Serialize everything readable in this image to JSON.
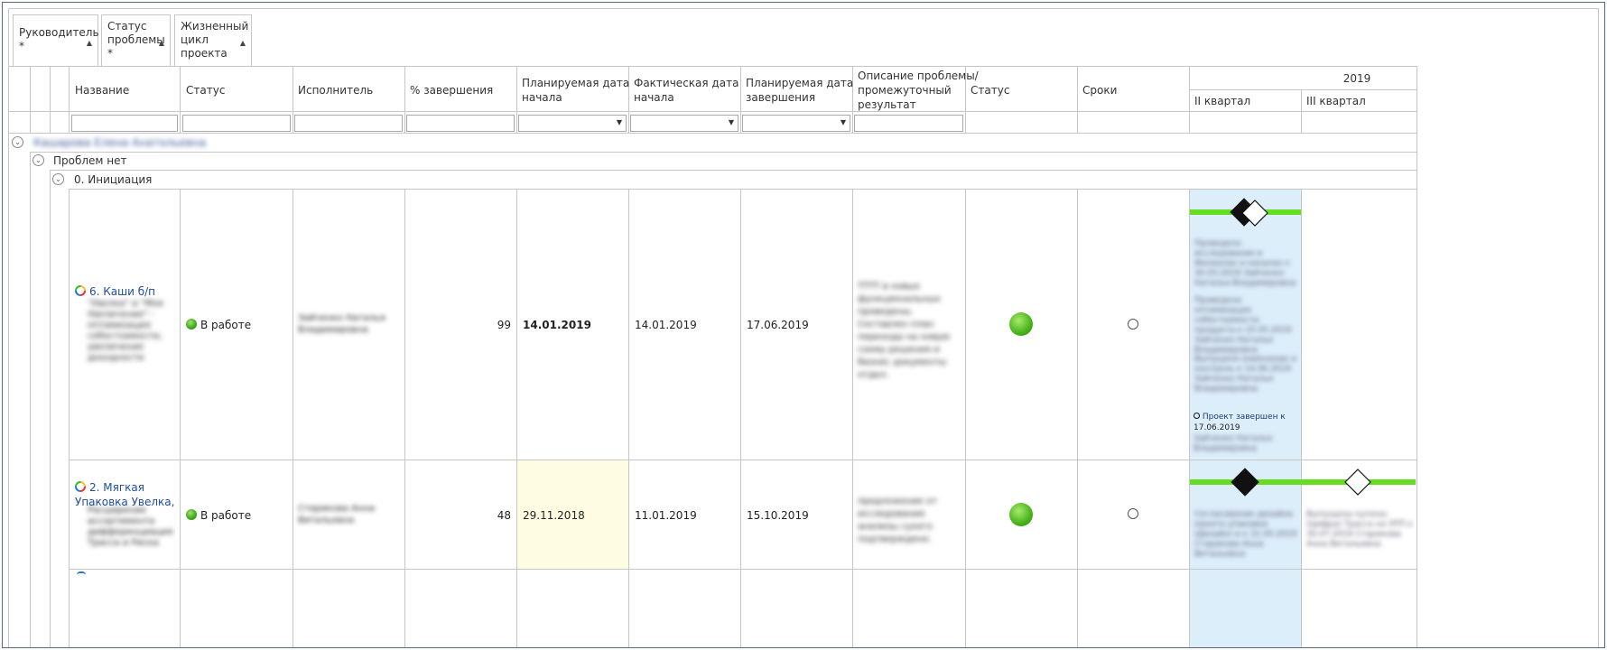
{
  "group_by": [
    {
      "label": "Руководитель\n*"
    },
    {
      "label": "Статус\nпроблемы\n*"
    },
    {
      "label": "Жизненный\nцикл\nпроекта"
    }
  ],
  "columns": {
    "name": "Название",
    "status": "Статус",
    "executor": "Исполнитель",
    "percent": "% завершения",
    "plan_start": "Планируемая дата\nначала",
    "fact_start": "Фактическая дата\nначала",
    "plan_end": "Планируемая дата\nзавершения",
    "problem_desc": "Описание проблемы/\nпромежуточный\nрезультат",
    "status2": "Статус",
    "terms": "Сроки",
    "year": "2019",
    "q2": "II квартал",
    "q3": "III квартал"
  },
  "groups": {
    "manager": "Кашарова Елена Анатольевна",
    "problem_status": "Проблем нет",
    "lifecycle": "0. Инициация"
  },
  "rows": [
    {
      "name": "6. Каши б/п",
      "name_extra": "\"Увелка\" и \"Мое Увеличение\" - оптимизация себестоимости, увеличение доходности",
      "status": "В работе",
      "executor": "Зайченко Наталья Владимировна",
      "percent": "99",
      "plan_start": "14.01.2019",
      "fact_start": "14.01.2019",
      "plan_end": "17.06.2019",
      "problem_desc": "ТТТТ в новых функциональных проведены. Составлен план перехода на новую схему решения и бизнес документы отдел.",
      "q2_notes": [
        "Проведено исследование в Филиалах и каналах к 30.03.2019 Зайченко Наталья Владимировна",
        "Проведена оптимизация себестоимости продукта к 15.05.2019 Зайченко Наталья Владимировна",
        "Выпущено изменение и контроль к 14.06.2019 Зайченко Наталья Владимировна"
      ],
      "q2_final": "Проект завершен к",
      "q2_final_date": "17.06.2019",
      "q2_final_person": "Зайченко Наталья Владимировна"
    },
    {
      "name": "2. Мягкая Упаковка Увелка,",
      "name_extra": "Расширение ассортимента дифференциация Трасса и Риска",
      "status": "В работе",
      "executor": "Старикова Анна Витальевна",
      "percent": "48",
      "plan_start": "29.11.2018",
      "fact_start": "11.01.2019",
      "plan_end": "15.10.2019",
      "problem_desc": "предложение от исследования анализы сухого подтверждено.",
      "q2_notes": [
        "Согласование дизайна макета упаковки (Дизайн) и к 31.05.2019 Старикова Анна Витальевна"
      ],
      "q3_notes": [
        "Выпущены купоны (Цифра) Трасса на ЭТП к 30.07.2019 Старикова Анна Витальевна"
      ]
    }
  ],
  "colors": {
    "status_green": "#47b31c",
    "gantt_bar": "#66dd22",
    "q2_highlight": "#ddeefb",
    "plan_start_highlight": "#fefde3"
  }
}
